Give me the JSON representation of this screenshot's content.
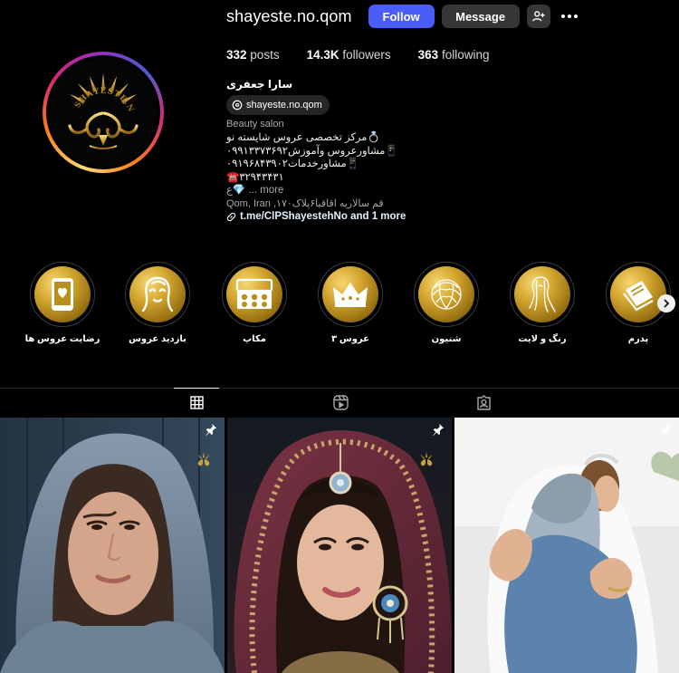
{
  "profile": {
    "username": "shayeste.no.qom",
    "follow_label": "Follow",
    "message_label": "Message",
    "full_name": "سارا جعفری",
    "threads_handle": "shayeste.no.qom",
    "category": "Beauty salon",
    "avatar_logo_text": "SHAYESTE.NO",
    "bio_lines": [
      "مرکز تخصصی عروس شایسته نو💍",
      "مشاورعروس وآموزش۰۹۹۱۳۳۷۳۶۹۲📱",
      "مشاورخدمات۰۹۱۹۶۸۴۳۹۰۲📱",
      "☎️۳۲۹۴۳۴۳۱",
      "ع💎 ... more"
    ],
    "address": "Qom, Iran ,قم سالاریه اقاقیا۶پلاک۱۷۰",
    "link": "t.me/ClPShayestehNo and 1 more"
  },
  "stats": {
    "posts_count": "332",
    "posts_label": "posts",
    "followers_count": "14.3K",
    "followers_label": "followers",
    "following_count": "363",
    "following_label": "following"
  },
  "highlights": [
    {
      "label": "رضایت عروس ها",
      "icon": "phone-heart-icon"
    },
    {
      "label": "بازدید عروس",
      "icon": "bride-face-icon"
    },
    {
      "label": "مکاپ",
      "icon": "eyeshadow-palette-icon"
    },
    {
      "label": "عروس ۳",
      "icon": "crown-icon"
    },
    {
      "label": "شنیون",
      "icon": "hair-bun-icon"
    },
    {
      "label": "رنگ و لایت",
      "icon": "hair-color-icon"
    },
    {
      "label": "پدرم",
      "icon": "book-icon"
    }
  ],
  "tabs": [
    {
      "name": "posts",
      "icon": "grid-icon",
      "active": true
    },
    {
      "name": "reels",
      "icon": "reels-icon",
      "active": false
    },
    {
      "name": "tagged",
      "icon": "tagged-icon",
      "active": false
    }
  ],
  "posts": [
    {
      "description": "bride-before-photo",
      "pinned": true
    },
    {
      "description": "bride-jewelry-photo",
      "pinned": true
    },
    {
      "description": "bride-hug-photo",
      "pinned": true
    }
  ],
  "colors": {
    "follow_button": "#4a5df9",
    "secondary_button": "#363636",
    "background": "#000000",
    "gold": "#d4a630"
  }
}
